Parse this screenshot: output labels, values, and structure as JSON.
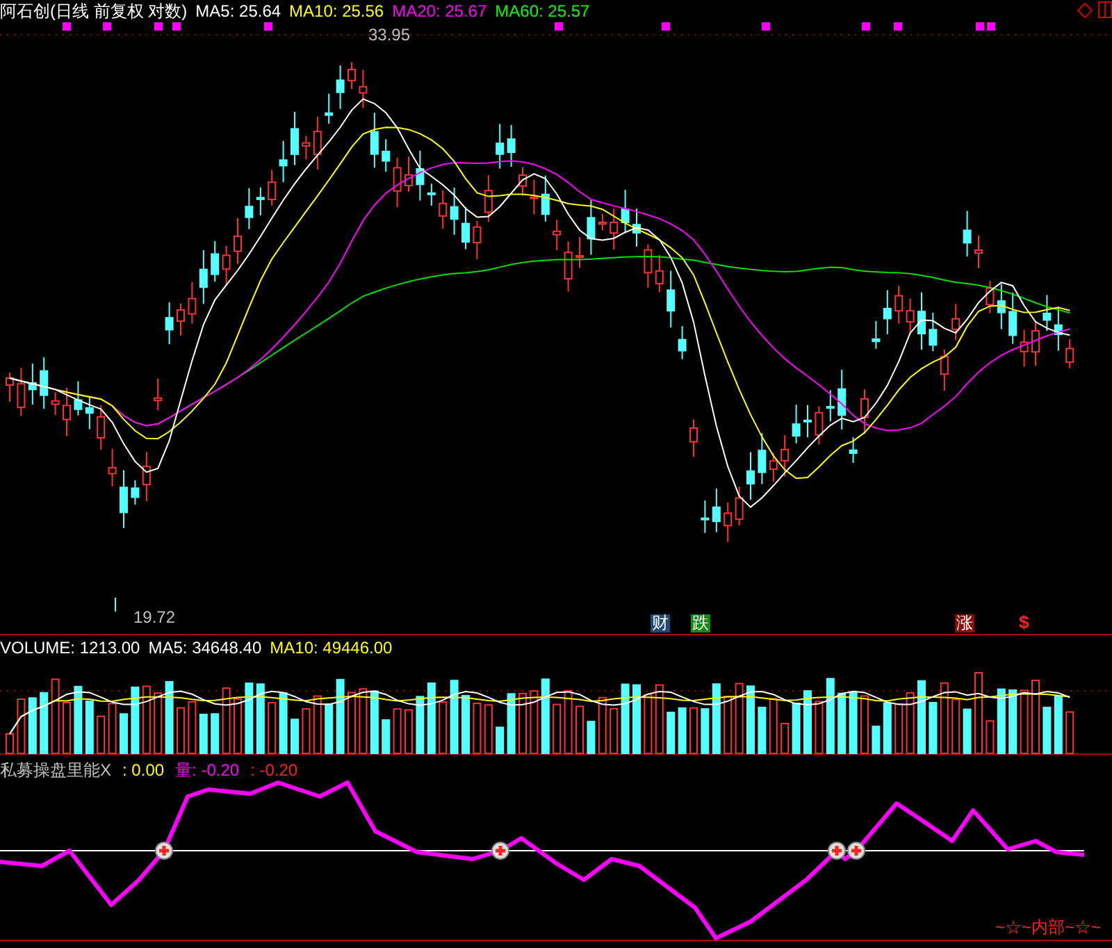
{
  "title": "阿石创(日线 前复权 对数)",
  "price_legend": [
    {
      "label": "MA5: 25.64",
      "color": "#ffffff"
    },
    {
      "label": "MA10: 25.56",
      "color": "#ffff00"
    },
    {
      "label": "MA20: 25.67",
      "color": "#ff00ff"
    },
    {
      "label": "MA60: 25.57",
      "color": "#00ff00"
    }
  ],
  "high_label": "33.95",
  "low_label": "19.72",
  "event_badges": [
    {
      "text": "财",
      "color": "#1e4a7a"
    },
    {
      "text": "跌",
      "color": "#138a13"
    },
    {
      "text": "涨",
      "color": "#8b0a0a"
    }
  ],
  "dollar_marker": "$",
  "volume_legend": [
    {
      "label": "VOLUME: 1213.00",
      "color": "#ffffff"
    },
    {
      "label": "MA5: 34648.40",
      "color": "#ffffff"
    },
    {
      "label": "MA10: 49446.00",
      "color": "#ffff00"
    }
  ],
  "indicator_legend": [
    {
      "label": "私募操盘里能X",
      "color": "#c0c0c0"
    },
    {
      "label": ": 0.00",
      "color": "#ffff00"
    },
    {
      "label": "量: -0.20",
      "color": "#ff00ff"
    },
    {
      "label": ": -0.20",
      "color": "#ff2020"
    }
  ],
  "footer_tag": "~☆~内部~☆~"
}
